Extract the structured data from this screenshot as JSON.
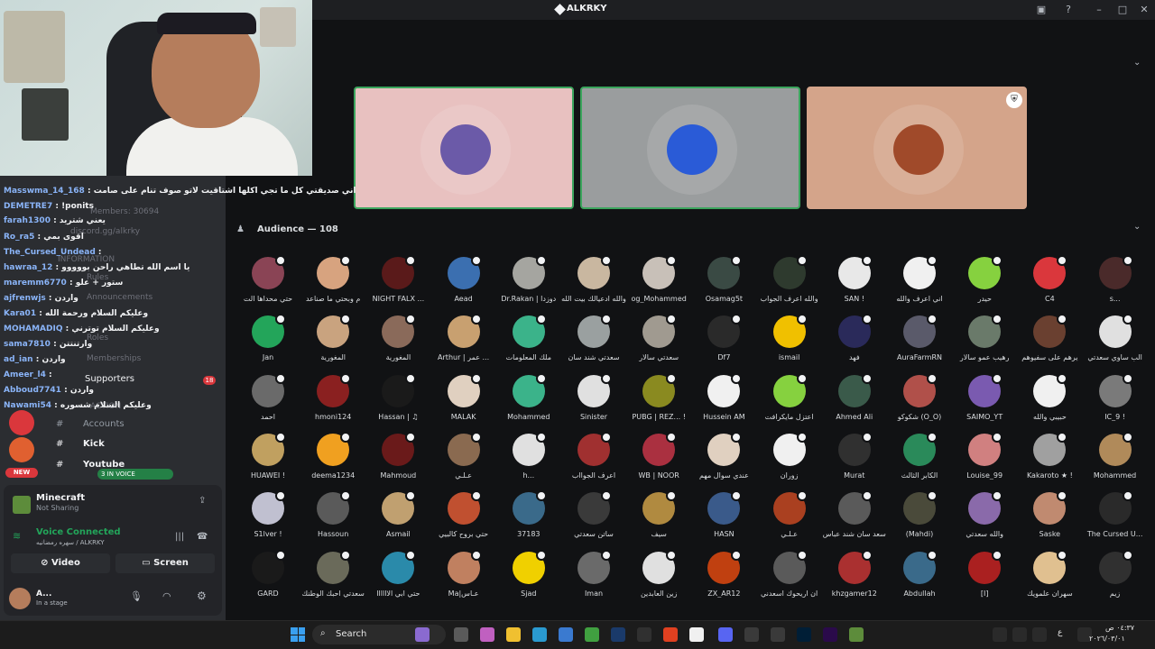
{
  "window": {
    "title": "ALKRKY"
  },
  "sidebar": {
    "chat": [
      {
        "user": "Masswma_14_168",
        "text": "اني صديقتي كل ما تجي اكلها اشتاقيت لاتو صوف تنام على صامت"
      },
      {
        "user": "DEMETRE7",
        "text": "!ponits"
      },
      {
        "user": "farah1300",
        "text": "يعني شتريد"
      },
      {
        "user": "Ro_ra5",
        "text": "اقوى بمي"
      },
      {
        "user": "The_Cursed_Undead",
        "text": ""
      },
      {
        "user": "hawraa_12",
        "text": "يا اسم الله تطاهي راحن بووووو"
      },
      {
        "user": "maremm6770",
        "text": "ستور + علو"
      },
      {
        "user": "ajfrenwjs",
        "text": "واردن"
      },
      {
        "user": "Kara01",
        "text": "وعليكم السلام ورحمة الله"
      },
      {
        "user": "MOHAMADIQ",
        "text": "وعليكم السلام توترني"
      },
      {
        "user": "sama7810",
        "text": "وارتنتتن"
      },
      {
        "user": "ad_ian",
        "text": "واردن"
      },
      {
        "user": "Ameer_l4",
        "text": ""
      },
      {
        "user": "Abboud7741",
        "text": "واردن"
      },
      {
        "user": "Nawami54",
        "text": "وعليكم السلام شسوره"
      }
    ],
    "ghost": {
      "members": "Members: 30694",
      "invite": "discord.gg/alkrky",
      "information": "INFORMATION",
      "rules": "Rules",
      "announcements": "Announcements",
      "roles": "Roles",
      "memberships": "Memberships",
      "action": "ACTION"
    },
    "channels": {
      "supporters": "Supporters",
      "supporters_badge": "18",
      "accounts": "Accounts",
      "kick": "Kick",
      "youtube": "Youtube"
    },
    "voice_pill": "3 IN VOICE",
    "new_pill": "NEW"
  },
  "panel": {
    "activity_title": "Minecraft",
    "activity_sub": "Not Sharing",
    "voice_status": "Voice Connected",
    "voice_sub": "سهره رمضانيه / ALKRKY",
    "video_label": "Video",
    "screen_label": "Screen",
    "user_name": "A...",
    "user_status": "In a stage"
  },
  "stage": {
    "audience_title": "Audience — 108",
    "tiles": [
      {
        "bg": "#e8c1c0",
        "avatar": "#6b5aa8",
        "border": "#3ba55d"
      },
      {
        "bg": "#9a9d9e",
        "avatar": "#2a5bd7",
        "border": "#3ba55d"
      },
      {
        "bg": "#d4a48a",
        "avatar": "#a04a2a",
        "border": "#d4a48a"
      }
    ]
  },
  "audience": [
    {
      "name": "حتي محداها الت",
      "color": "#8a4455"
    },
    {
      "name": "م وبحتي ما صناعد",
      "color": "#d7a37f"
    },
    {
      "name": "NIGHT FALX ...",
      "color": "#5a1a1a"
    },
    {
      "name": "Aead",
      "color": "#3b6fb0"
    },
    {
      "name": "Dr.Rakan | دوزدا",
      "color": "#a5a5a0"
    },
    {
      "name": "والله ادعيالك بيت الله",
      "color": "#c9b7a0"
    },
    {
      "name": "og_Mohammed",
      "color": "#c8c0b8"
    },
    {
      "name": "Osamag5t",
      "color": "#3a4a44"
    },
    {
      "name": "والله اعرف الجواب",
      "color": "#2e3a2e"
    },
    {
      "name": "SAN !",
      "color": "#e8e8e8"
    },
    {
      "name": "اني اعرف والله",
      "color": "#f0f0f0"
    },
    {
      "name": "حيدر",
      "color": "#86d13f"
    },
    {
      "name": "C4",
      "color": "#da373c"
    },
    {
      "name": "s...",
      "color": "#4a2a2a"
    },
    {
      "name": "Jan",
      "color": "#23a55a"
    },
    {
      "name": "المغورية",
      "color": "#c9a37f"
    },
    {
      "name": "المغورية",
      "color": "#8a6a5a"
    },
    {
      "name": "Arthur | عمر ...",
      "color": "#c8a070"
    },
    {
      "name": "ملك المعلومات",
      "color": "#3bb38a"
    },
    {
      "name": "سعدتي شند سان",
      "color": "#9aa0a0"
    },
    {
      "name": "سعدتي سالار",
      "color": "#a09a90"
    },
    {
      "name": "Df7",
      "color": "#2a2a2a"
    },
    {
      "name": "ismail",
      "color": "#f0c000"
    },
    {
      "name": "فهد",
      "color": "#2a2a5a"
    },
    {
      "name": "AuraFarmRN",
      "color": "#5a5a6a"
    },
    {
      "name": "رهيب عمو سالار",
      "color": "#6a7a6a"
    },
    {
      "name": "يرهم على سفيوهم",
      "color": "#6a4030"
    },
    {
      "name": "الب ساوي سعدتي",
      "color": "#e0e0e0"
    },
    {
      "name": "احمد",
      "color": "#6a6a6a"
    },
    {
      "name": "hmoni124",
      "color": "#8a2020"
    },
    {
      "name": "Hassan | ♫",
      "color": "#1a1a1a"
    },
    {
      "name": "MALAK",
      "color": "#e0d0c0"
    },
    {
      "name": "Mohammed",
      "color": "#3bb38a"
    },
    {
      "name": "Sinister",
      "color": "#e0e0e0"
    },
    {
      "name": "PUBG | REZ... !",
      "color": "#8a8a20"
    },
    {
      "name": "Hussein AM",
      "color": "#f0f0f0"
    },
    {
      "name": "اعتزل مايكرافت",
      "color": "#86d13f"
    },
    {
      "name": "Ahmed Ali",
      "color": "#3a5a4a"
    },
    {
      "name": "شكوكو (O_O)",
      "color": "#b0504a"
    },
    {
      "name": "SAIMO_YT",
      "color": "#7a5ab0"
    },
    {
      "name": "حبيبي والله",
      "color": "#f0f0f0"
    },
    {
      "name": "IC_9 !",
      "color": "#7a7a7a"
    },
    {
      "name": "HUAWEI !",
      "color": "#c0a060"
    },
    {
      "name": "deema1234",
      "color": "#f0a020"
    },
    {
      "name": "Mahmoud",
      "color": "#6a1a1a"
    },
    {
      "name": "عـلـي",
      "color": "#8a6a50"
    },
    {
      "name": "h...",
      "color": "#e0e0e0"
    },
    {
      "name": "اعرف الجوااب",
      "color": "#a03030"
    },
    {
      "name": "WB | NOOR",
      "color": "#aa3040"
    },
    {
      "name": "عندي سوال مهم",
      "color": "#e0d0c0"
    },
    {
      "name": "زوران",
      "color": "#f0f0f0"
    },
    {
      "name": "Murat",
      "color": "#303030"
    },
    {
      "name": "الكابر الثالث",
      "color": "#2a8a5a"
    },
    {
      "name": "Louise_99",
      "color": "#d08080"
    },
    {
      "name": "Kakaroto ★ !",
      "color": "#a0a0a0"
    },
    {
      "name": "Mohammed",
      "color": "#b08a5a"
    },
    {
      "name": "S1lver !",
      "color": "#c0c0d0"
    },
    {
      "name": "Hassoun",
      "color": "#5a5a5a"
    },
    {
      "name": "Asmail",
      "color": "#c0a070"
    },
    {
      "name": "حتي بروح كالبيي",
      "color": "#c05030"
    },
    {
      "name": "37183",
      "color": "#3a6a8a"
    },
    {
      "name": "ساتن سعدتي",
      "color": "#3a3a3a"
    },
    {
      "name": "سيف",
      "color": "#b08a40"
    },
    {
      "name": "HASN",
      "color": "#3a5a8a"
    },
    {
      "name": "عـلـي",
      "color": "#aa4020"
    },
    {
      "name": "سعد سان شند عباس",
      "color": "#5a5a5a"
    },
    {
      "name": "(Mahdi)",
      "color": "#4a4a3a"
    },
    {
      "name": "والله سعدتي",
      "color": "#8a6aaa"
    },
    {
      "name": "Saske",
      "color": "#c08a70"
    },
    {
      "name": "The Cursed U...",
      "color": "#2a2a2a"
    },
    {
      "name": "GARD",
      "color": "#1a1a1a"
    },
    {
      "name": "سعدتي احبك الوطنك",
      "color": "#6a6a5a"
    },
    {
      "name": "حتي ابي الاااااا",
      "color": "#2a8aaa"
    },
    {
      "name": "Ma|عـاس",
      "color": "#c08060"
    },
    {
      "name": "Sjad",
      "color": "#f0d000"
    },
    {
      "name": "Iman",
      "color": "#6a6a6a"
    },
    {
      "name": "زين العابدين",
      "color": "#e0e0e0"
    },
    {
      "name": "ZX_AR12",
      "color": "#c04010"
    },
    {
      "name": "ان اريحوك اسعدني",
      "color": "#5a5a5a"
    },
    {
      "name": "khzgamer12",
      "color": "#aa3030"
    },
    {
      "name": "Abdullah",
      "color": "#3a6a8a"
    },
    {
      "name": "[I]",
      "color": "#aa2020"
    },
    {
      "name": "سهران علمويك",
      "color": "#e0c090"
    },
    {
      "name": "زيم",
      "color": "#303030"
    }
  ],
  "taskbar": {
    "search_placeholder": "Search",
    "time": "٠٤:٣٧ ص",
    "date": "٢٠٢٦/٠٣/٠١",
    "lang": "ع"
  }
}
